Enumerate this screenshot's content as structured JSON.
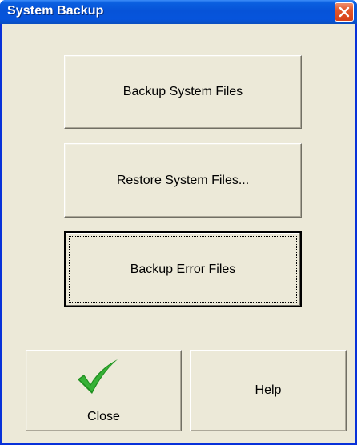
{
  "window": {
    "title": "System Backup"
  },
  "buttons": {
    "backup_system_files": "Backup System Files",
    "restore_system_files": "Restore System Files...",
    "backup_error_files": "Backup Error Files",
    "close": "Close",
    "help": "Help"
  },
  "icons": {
    "close_button_icon": "checkmark-icon",
    "titlebar_close_icon": "close-icon"
  },
  "colors": {
    "titlebar": "#0654dc",
    "client_background": "#ece9d8",
    "titlebar_close": "#d6411a",
    "checkmark": "#1f8f1f"
  }
}
